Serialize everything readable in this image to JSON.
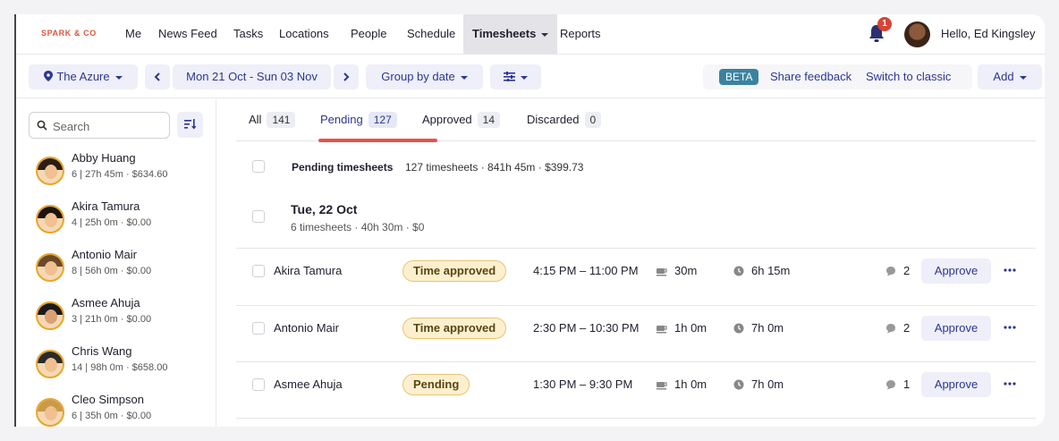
{
  "brand": "SPARK & CO",
  "nav": {
    "items": [
      "Me",
      "News Feed",
      "Tasks",
      "Locations",
      "People",
      "Schedule",
      "Timesheets",
      "Reports"
    ],
    "notifications": "1",
    "greeting": "Hello, Ed Kingsley"
  },
  "toolbar": {
    "location": "The Azure",
    "date_range": "Mon 21 Oct - Sun 03 Nov",
    "group_by": "Group by date",
    "beta": "BETA",
    "share_feedback": "Share feedback",
    "switch_classic": "Switch to classic",
    "add": "Add"
  },
  "sidebar": {
    "search_placeholder": "Search",
    "people": [
      {
        "name": "Abby Huang",
        "meta": "6 | 27h 45m · $634.60"
      },
      {
        "name": "Akira Tamura",
        "meta": "4 | 25h 0m · $0.00"
      },
      {
        "name": "Antonio Mair",
        "meta": "8 | 56h 0m · $0.00"
      },
      {
        "name": "Asmee Ahuja",
        "meta": "3 | 21h 0m · $0.00"
      },
      {
        "name": "Chris Wang",
        "meta": "14 | 98h 0m · $658.00"
      },
      {
        "name": "Cleo Simpson",
        "meta": "6 | 35h 0m · $0.00"
      }
    ]
  },
  "tabs": [
    {
      "label": "All",
      "count": "141"
    },
    {
      "label": "Pending",
      "count": "127"
    },
    {
      "label": "Approved",
      "count": "14"
    },
    {
      "label": "Discarded",
      "count": "0"
    }
  ],
  "summary": {
    "title": "Pending timesheets",
    "details": "127 timesheets · 841h 45m · $399.73"
  },
  "day": {
    "title": "Tue, 22 Oct",
    "details": "6 timesheets · 40h 30m · $0"
  },
  "rows": [
    {
      "name": "Akira Tamura",
      "status": "Time approved",
      "time": "4:15 PM – 11:00 PM",
      "break": "30m",
      "duration": "6h 15m",
      "comments": "2",
      "action": "Approve"
    },
    {
      "name": "Antonio Mair",
      "status": "Time approved",
      "time": "2:30 PM – 10:30 PM",
      "break": "1h 0m",
      "duration": "7h 0m",
      "comments": "2",
      "action": "Approve"
    },
    {
      "name": "Asmee Ahuja",
      "status": "Pending",
      "time": "1:30 PM – 9:30 PM",
      "break": "1h 0m",
      "duration": "7h 0m",
      "comments": "1",
      "action": "Approve"
    }
  ],
  "colors": {
    "accent": "#2d3694",
    "brand": "#e2553b",
    "underline": "#e6524e",
    "status_bg": "#fdf0cf"
  }
}
